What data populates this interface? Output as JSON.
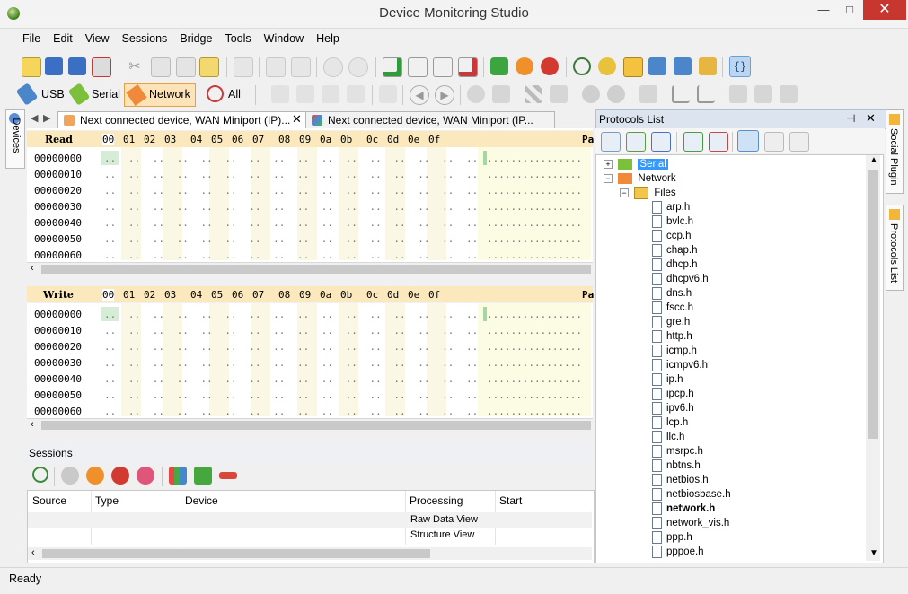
{
  "window": {
    "title": "Device Monitoring Studio",
    "minimize": "—",
    "maximize": "□",
    "close": "✕"
  },
  "menu": [
    "File",
    "Edit",
    "View",
    "Sessions",
    "Bridge",
    "Tools",
    "Window",
    "Help"
  ],
  "filter_toolbar": {
    "usb": "USB",
    "serial": "Serial",
    "network": "Network",
    "all": "All"
  },
  "devices_panel": {
    "label": "Devices"
  },
  "doc_tabs": [
    {
      "label": "Next connected device, WAN Miniport (IP)...",
      "close": "✕"
    },
    {
      "label": "Next connected device, WAN Miniport (IP..."
    }
  ],
  "hex_columns": [
    "00",
    "01",
    "02",
    "03",
    "04",
    "05",
    "06",
    "07",
    "08",
    "09",
    "0a",
    "0b",
    "0c",
    "0d",
    "0e",
    "0f"
  ],
  "hex_tail": "Pa",
  "read_panel": {
    "title": "Read",
    "addresses": [
      "00000000",
      "00000010",
      "00000020",
      "00000030",
      "00000040",
      "00000050",
      "00000060"
    ]
  },
  "write_panel": {
    "title": "Write",
    "addresses": [
      "00000000",
      "00000010",
      "00000020",
      "00000030",
      "00000040",
      "00000050",
      "00000060"
    ]
  },
  "sessions": {
    "title": "Sessions",
    "columns": [
      "Source",
      "Type",
      "Device",
      "Processing",
      "Start"
    ],
    "rows": [
      "Raw Data View",
      "Structure View"
    ]
  },
  "protocols": {
    "title": "Protocols List",
    "tree": {
      "serial": "Serial",
      "network": "Network",
      "files": "Files",
      "items": [
        "arp.h",
        "bvlc.h",
        "ccp.h",
        "chap.h",
        "dhcp.h",
        "dhcpv6.h",
        "dns.h",
        "fscc.h",
        "gre.h",
        "http.h",
        "icmp.h",
        "icmpv6.h",
        "ip.h",
        "ipcp.h",
        "ipv6.h",
        "lcp.h",
        "llc.h",
        "msrpc.h",
        "nbtns.h",
        "netbios.h",
        "netbiosbase.h",
        "network.h",
        "network_vis.h",
        "ppp.h",
        "pppoe.h"
      ],
      "bold_item": "network.h"
    }
  },
  "right_tabs": {
    "social": "Social Plugin",
    "protocols": "Protocols List"
  },
  "status": {
    "text": "Ready"
  },
  "colors": {
    "hex_header": "#fbe9bd",
    "selection": "#3399ff",
    "accent_network": "#f5a25d"
  }
}
